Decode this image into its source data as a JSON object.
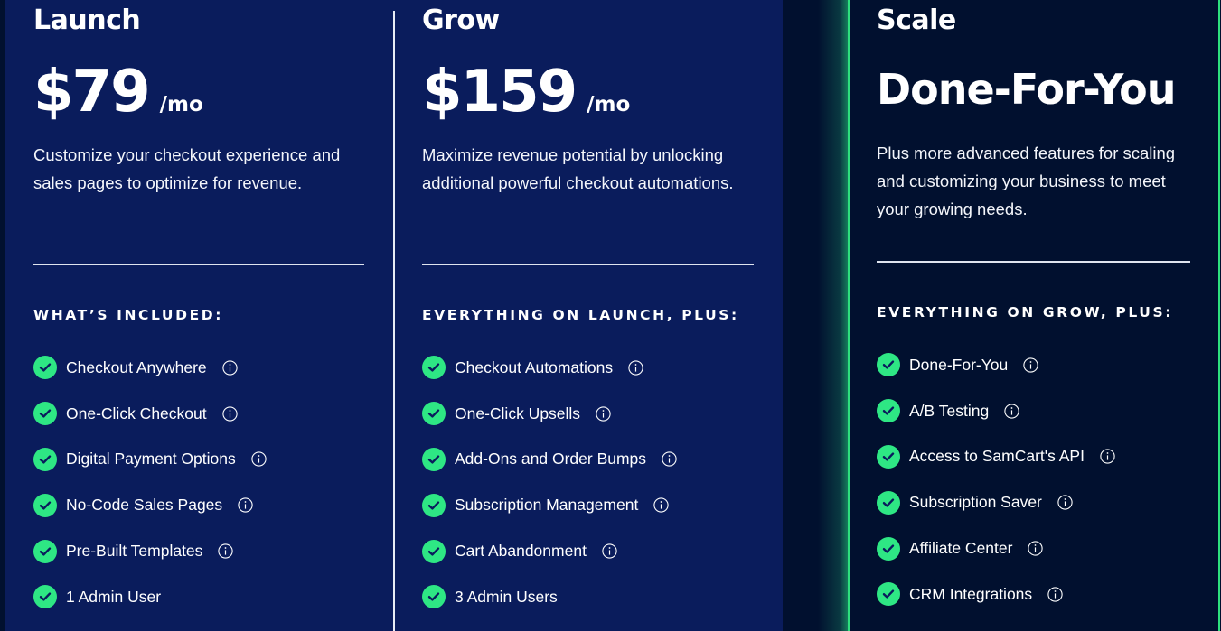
{
  "colors": {
    "panel_blue": "#0a1c5c",
    "background": "#01102f",
    "accent_green": "#2ee784",
    "text": "#ffffff"
  },
  "plans": [
    {
      "name": "Launch",
      "price": "$79",
      "period": "/mo",
      "description": "Customize your checkout experience and sales pages to optimize for revenue.",
      "section_label": "WHAT’S INCLUDED:",
      "features": [
        {
          "label": "Checkout Anywhere",
          "info": true
        },
        {
          "label": "One-Click Checkout",
          "info": true
        },
        {
          "label": "Digital Payment Options",
          "info": true
        },
        {
          "label": "No-Code Sales Pages",
          "info": true
        },
        {
          "label": "Pre-Built Templates",
          "info": true
        },
        {
          "label": "1 Admin User",
          "info": false
        }
      ]
    },
    {
      "name": "Grow",
      "price": "$159",
      "period": "/mo",
      "description": "Maximize revenue potential by unlocking additional powerful checkout automations.",
      "section_label": "EVERYTHING ON LAUNCH, PLUS:",
      "features": [
        {
          "label": "Checkout Automations",
          "info": true
        },
        {
          "label": "One-Click Upsells",
          "info": true
        },
        {
          "label": "Add-Ons and Order Bumps",
          "info": true
        },
        {
          "label": "Subscription Management",
          "info": true
        },
        {
          "label": "Cart Abandonment",
          "info": true
        },
        {
          "label": "3 Admin Users",
          "info": false
        }
      ]
    },
    {
      "name": "Scale",
      "headline": "Done-For-You",
      "description": "Plus more advanced features for scaling and customizing your business to meet your growing needs.",
      "section_label": "EVERYTHING ON GROW, PLUS:",
      "features": [
        {
          "label": "Done-For-You",
          "info": true
        },
        {
          "label": "A/B Testing",
          "info": true
        },
        {
          "label": "Access to SamCart's API",
          "info": true
        },
        {
          "label": "Subscription Saver",
          "info": true
        },
        {
          "label": "Affiliate Center",
          "info": true
        },
        {
          "label": "CRM Integrations",
          "info": true
        }
      ]
    }
  ],
  "icons": {
    "feature_check": "check-circle-icon",
    "feature_info": "info-circle-icon"
  }
}
